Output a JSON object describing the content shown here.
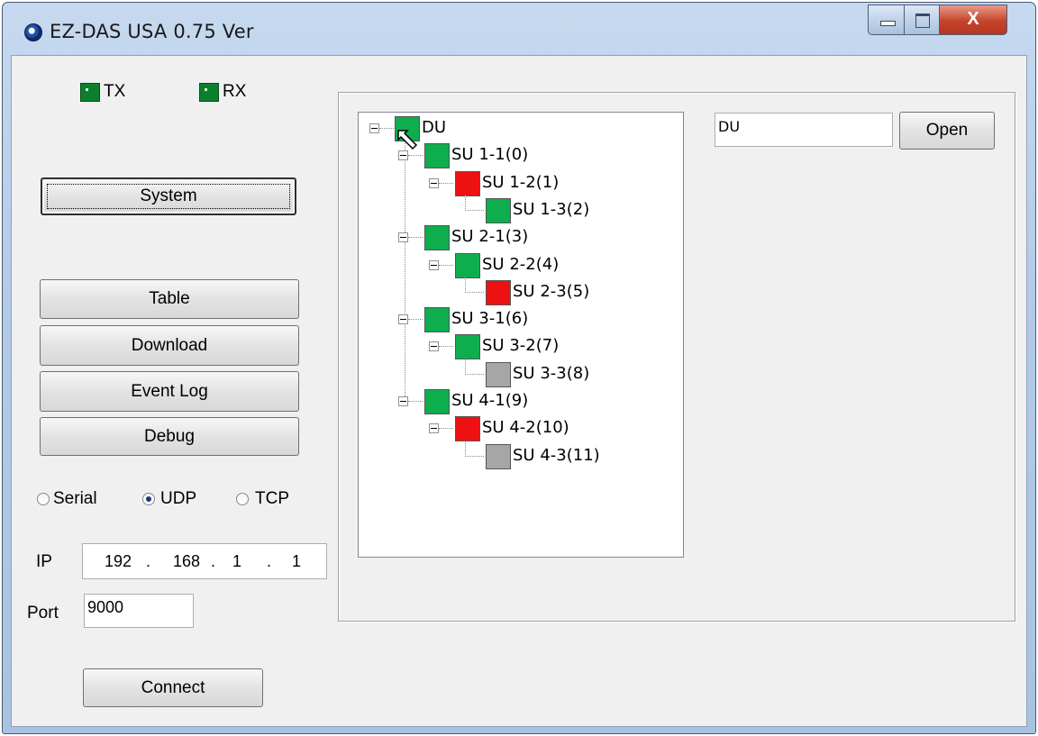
{
  "window": {
    "title": "EZ-DAS USA 0.75 Ver",
    "close_glyph": "X",
    "minimize_icon": "minimize-icon",
    "maximize_icon": "maximize-icon"
  },
  "indicators": {
    "tx_label": "TX",
    "rx_label": "RX",
    "tx_color": "#0b7f2c",
    "rx_color": "#0b7f2c"
  },
  "buttons": {
    "system": "System",
    "table": "Table",
    "download": "Download",
    "event_log": "Event Log",
    "debug": "Debug",
    "connect": "Connect",
    "open": "Open"
  },
  "connection": {
    "modes": [
      {
        "label": "Serial",
        "selected": false
      },
      {
        "label": "UDP",
        "selected": true
      },
      {
        "label": "TCP",
        "selected": false
      }
    ],
    "ip_label": "IP",
    "ip": [
      "192",
      "168",
      "1",
      "1"
    ],
    "ip_dot": ".",
    "port_label": "Port",
    "port": "9000"
  },
  "selected_node_field": "DU",
  "status_colors": {
    "ok": "#0ead4e",
    "alarm": "#ee1111",
    "offline": "#a6a6a6",
    "du": "#0ead4e"
  },
  "tree": {
    "root": {
      "label": "DU",
      "status": "du"
    },
    "nodes": [
      {
        "label": "SU 1-1(0)",
        "status": "ok",
        "level": 1
      },
      {
        "label": "SU 1-2(1)",
        "status": "alarm",
        "level": 2
      },
      {
        "label": "SU 1-3(2)",
        "status": "ok",
        "level": 3
      },
      {
        "label": "SU 2-1(3)",
        "status": "ok",
        "level": 1
      },
      {
        "label": "SU 2-2(4)",
        "status": "ok",
        "level": 2
      },
      {
        "label": "SU 2-3(5)",
        "status": "alarm",
        "level": 3
      },
      {
        "label": "SU 3-1(6)",
        "status": "ok",
        "level": 1
      },
      {
        "label": "SU 3-2(7)",
        "status": "ok",
        "level": 2
      },
      {
        "label": "SU 3-3(8)",
        "status": "offline",
        "level": 3
      },
      {
        "label": "SU 4-1(9)",
        "status": "ok",
        "level": 1
      },
      {
        "label": "SU 4-2(10)",
        "status": "alarm",
        "level": 2
      },
      {
        "label": "SU 4-3(11)",
        "status": "offline",
        "level": 3
      }
    ]
  }
}
